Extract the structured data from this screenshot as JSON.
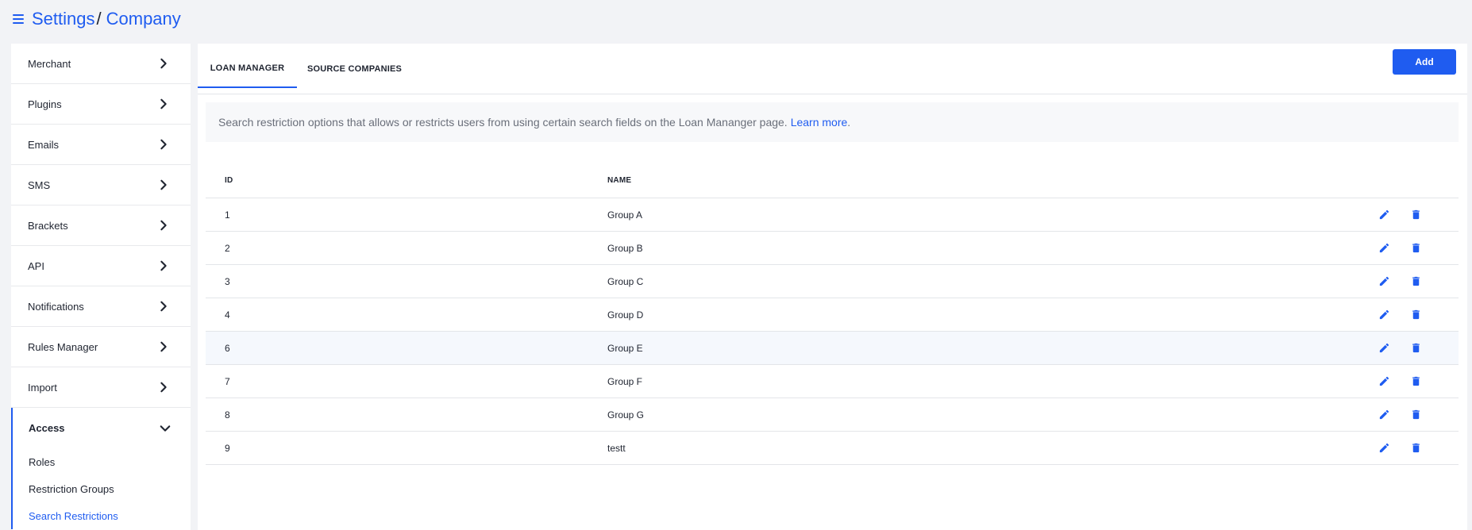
{
  "header": {
    "breadcrumb_root": "Settings",
    "breadcrumb_sep": "/",
    "breadcrumb_current": "Company"
  },
  "sidebar": {
    "items": [
      {
        "label": "Merchant",
        "icon": "chevron-right-icon"
      },
      {
        "label": "Plugins",
        "icon": "chevron-right-icon"
      },
      {
        "label": "Emails",
        "icon": "chevron-right-icon"
      },
      {
        "label": "SMS",
        "icon": "chevron-right-icon"
      },
      {
        "label": "Brackets",
        "icon": "chevron-right-icon"
      },
      {
        "label": "API",
        "icon": "chevron-right-icon"
      },
      {
        "label": "Notifications",
        "icon": "chevron-right-icon"
      },
      {
        "label": "Rules Manager",
        "icon": "chevron-right-icon"
      },
      {
        "label": "Import",
        "icon": "chevron-right-icon"
      }
    ],
    "access": {
      "label": "Access",
      "icon": "chevron-down-icon",
      "children": [
        {
          "label": "Roles"
        },
        {
          "label": "Restriction Groups"
        },
        {
          "label": "Search Restrictions",
          "active": true
        }
      ]
    }
  },
  "tabs": [
    {
      "label": "LOAN MANAGER",
      "active": true
    },
    {
      "label": "SOURCE COMPANIES",
      "active": false
    }
  ],
  "toolbar": {
    "add_label": "Add"
  },
  "info": {
    "text": "Search restriction options that allows or restricts users from using certain search fields on the Loan Mananger page.",
    "link_text": "Learn more",
    "suffix": "."
  },
  "table": {
    "columns": [
      "ID",
      "NAME"
    ],
    "rows": [
      {
        "id": "1",
        "name": "Group A"
      },
      {
        "id": "2",
        "name": "Group B"
      },
      {
        "id": "3",
        "name": "Group C"
      },
      {
        "id": "4",
        "name": "Group D"
      },
      {
        "id": "6",
        "name": "Group E"
      },
      {
        "id": "7",
        "name": "Group F"
      },
      {
        "id": "8",
        "name": "Group G"
      },
      {
        "id": "9",
        "name": "testt"
      }
    ],
    "row_actions": [
      "edit-icon",
      "delete-icon"
    ]
  },
  "colors": {
    "accent": "#1f5cf0",
    "page_bg": "#f2f3f6"
  }
}
